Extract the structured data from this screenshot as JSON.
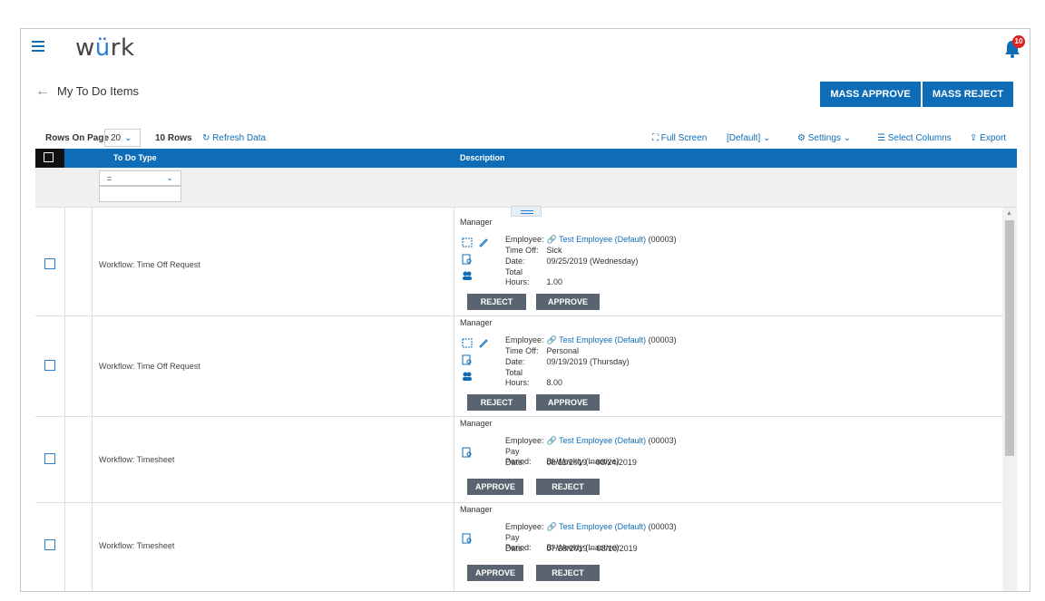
{
  "app": {
    "logo_prefix": "w",
    "logo_accent": "ü",
    "logo_suffix": "rk",
    "notification_count": "10"
  },
  "page": {
    "back_arrow": "←",
    "title": "My To Do Items"
  },
  "actions": {
    "mass_approve": "MASS APPROVE",
    "mass_reject": "MASS REJECT"
  },
  "toolbar": {
    "rows_on_page_label": "Rows On Page",
    "rows_on_page_value": "20",
    "row_count": "10 Rows",
    "refresh": "Refresh Data",
    "full_screen": "Full Screen",
    "view": "[Default]",
    "settings": "Settings",
    "select_columns": "Select Columns",
    "export": "Export"
  },
  "grid": {
    "columns": [
      "To Do Type",
      "Description"
    ],
    "filter_operator": "=",
    "rows": [
      {
        "type": "Workflow: Time Off Request",
        "role": "Manager",
        "fields": [
          {
            "k": "Employee:",
            "link": "Test Employee (Default)",
            "v": " (00003)"
          },
          {
            "k": "Time Off:",
            "v": "Sick"
          },
          {
            "k": "Date:",
            "v": "09/25/2019 (Wednesday)"
          },
          {
            "k": "Total Hours:",
            "v": "1.00"
          }
        ],
        "buttons": [
          "REJECT",
          "APPROVE"
        ]
      },
      {
        "type": "Workflow: Time Off Request",
        "role": "Manager",
        "fields": [
          {
            "k": "Employee:",
            "link": "Test Employee (Default)",
            "v": " (00003)"
          },
          {
            "k": "Time Off:",
            "v": "Personal"
          },
          {
            "k": "Date:",
            "v": "09/19/2019 (Thursday)"
          },
          {
            "k": "Total Hours:",
            "v": "8.00"
          }
        ],
        "buttons": [
          "REJECT",
          "APPROVE"
        ]
      },
      {
        "type": "Workflow: Timesheet",
        "role": "Manager",
        "fields": [
          {
            "k": "Employee:",
            "link": "Test Employee (Default)",
            "v": " (00003)"
          },
          {
            "k": "Pay Period:",
            "v": "Bi-Weekly (Inactive)"
          },
          {
            "k": "Date:",
            "v": "08/11/2019 – 08/24/2019"
          }
        ],
        "buttons": [
          "APPROVE",
          "REJECT"
        ]
      },
      {
        "type": "Workflow: Timesheet",
        "role": "Manager",
        "fields": [
          {
            "k": "Employee:",
            "link": "Test Employee (Default)",
            "v": " (00003)"
          },
          {
            "k": "Pay Period:",
            "v": "Bi-Weekly (Inactive)"
          },
          {
            "k": "Date:",
            "v": "07/28/2019 – 08/10/2019"
          }
        ],
        "buttons": [
          "APPROVE",
          "REJECT"
        ]
      }
    ]
  }
}
